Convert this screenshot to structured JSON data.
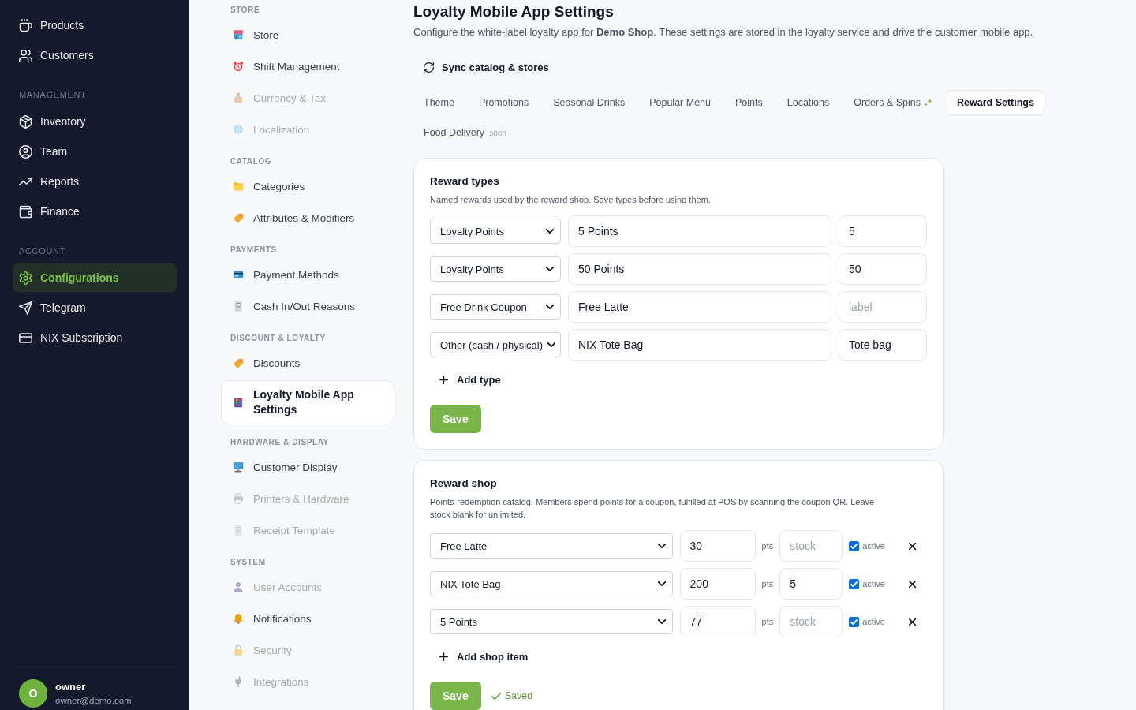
{
  "sidebar": {
    "sections": [
      {
        "items": [
          {
            "label": "Products",
            "selected": false
          },
          {
            "label": "Customers",
            "selected": false
          }
        ]
      },
      {
        "heading": "MANAGEMENT",
        "items": [
          {
            "label": "Inventory",
            "selected": false
          },
          {
            "label": "Team",
            "selected": false
          },
          {
            "label": "Reports",
            "selected": false
          },
          {
            "label": "Finance",
            "selected": false
          }
        ]
      },
      {
        "heading": "ACCOUNT",
        "items": [
          {
            "label": "Configurations",
            "selected": true
          },
          {
            "label": "Telegram",
            "selected": false
          },
          {
            "label": "NIX Subscription",
            "selected": false
          }
        ]
      }
    ],
    "user": {
      "initial": "O",
      "name": "owner",
      "email": "owner@demo.com"
    }
  },
  "settings_nav": {
    "sections": [
      {
        "heading": "STORE",
        "items": [
          {
            "label": "Store",
            "selected": false,
            "disabled": false
          },
          {
            "label": "Shift Management",
            "selected": false,
            "disabled": false
          },
          {
            "label": "Currency & Tax",
            "selected": false,
            "disabled": true
          },
          {
            "label": "Localization",
            "selected": false,
            "disabled": true
          }
        ]
      },
      {
        "heading": "CATALOG",
        "items": [
          {
            "label": "Categories",
            "selected": false,
            "disabled": false
          },
          {
            "label": "Attributes & Modifiers",
            "selected": false,
            "disabled": false
          }
        ]
      },
      {
        "heading": "PAYMENTS",
        "items": [
          {
            "label": "Payment Methods",
            "selected": false,
            "disabled": false
          },
          {
            "label": "Cash In/Out Reasons",
            "selected": false,
            "disabled": false
          }
        ]
      },
      {
        "heading": "DISCOUNT & LOYALTY",
        "items": [
          {
            "label": "Discounts",
            "selected": false,
            "disabled": false
          },
          {
            "label": "Loyalty Mobile App Settings",
            "selected": true,
            "disabled": false
          }
        ]
      },
      {
        "heading": "HARDWARE & DISPLAY",
        "items": [
          {
            "label": "Customer Display",
            "selected": false,
            "disabled": false
          },
          {
            "label": "Printers & Hardware",
            "selected": false,
            "disabled": true
          },
          {
            "label": "Receipt Template",
            "selected": false,
            "disabled": true
          }
        ]
      },
      {
        "heading": "SYSTEM",
        "items": [
          {
            "label": "User Accounts",
            "selected": false,
            "disabled": true
          },
          {
            "label": "Notifications",
            "selected": false,
            "disabled": false
          },
          {
            "label": "Security",
            "selected": false,
            "disabled": true
          },
          {
            "label": "Integrations",
            "selected": false,
            "disabled": true
          }
        ]
      }
    ]
  },
  "page": {
    "title": "Loyalty Mobile App Settings",
    "description": "Configure the white-label loyalty app for **Demo Shop**. These settings are stored in the loyalty service and drive the customer mobile app.",
    "sync_button": "Sync catalog & stores"
  },
  "tabs": [
    {
      "label": "Theme",
      "selected": false
    },
    {
      "label": "Promotions",
      "selected": false
    },
    {
      "label": "Seasonal Drinks",
      "selected": false
    },
    {
      "label": "Popular Menu",
      "selected": false
    },
    {
      "label": "Points",
      "selected": false
    },
    {
      "label": "Locations",
      "selected": false
    },
    {
      "label": "Orders & Spins",
      "selected": false
    },
    {
      "label": "Reward Settings",
      "selected": true
    },
    {
      "label": "Food Delivery",
      "selected": false,
      "tag": "soon"
    }
  ],
  "reward_types": {
    "title": "Reward types",
    "description": "Named rewards used by the reward shop. Save types before using them.",
    "rows": [
      {
        "type": "Loyalty Points",
        "name": "5 Points",
        "label": {
          "value": "5"
        }
      },
      {
        "type": "Loyalty Points",
        "name": "50 Points",
        "label": {
          "value": "50"
        }
      },
      {
        "type": "Free Drink Coupon",
        "name": "Free Latte",
        "label": {
          "placeholder": "label"
        }
      },
      {
        "type": "Other (cash / physical)",
        "name": "NIX Tote Bag",
        "label": {
          "value": "Tote bag"
        }
      }
    ],
    "add_button": "Add type",
    "save_button": "Save"
  },
  "reward_shop": {
    "title": "Reward shop",
    "description": "Points-redemption catalog. Members spend points for a coupon, fulfilled at POS by scanning the coupon QR. Leave stock blank for unlimited.",
    "items": [
      {
        "reward": "Free Latte",
        "points": "30",
        "unit": "pts",
        "stock": {
          "placeholder": "stock"
        },
        "active": true,
        "active_label": "active"
      },
      {
        "reward": "NIX Tote Bag",
        "points": "200",
        "unit": "pts",
        "stock": {
          "value": "5"
        },
        "active": true,
        "active_label": "active"
      },
      {
        "reward": "5 Points",
        "points": "77",
        "unit": "pts",
        "stock": {
          "placeholder": "stock"
        },
        "active": true,
        "active_label": "active"
      }
    ],
    "add_button": "Add shop item",
    "save_button": "Save",
    "status": "Saved"
  }
}
